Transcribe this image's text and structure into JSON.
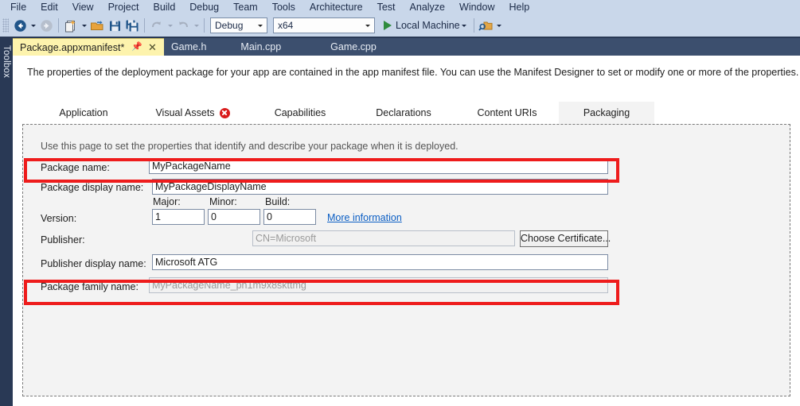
{
  "menubar": {
    "items": [
      {
        "label": "File",
        "accel": "F"
      },
      {
        "label": "Edit",
        "accel": "E"
      },
      {
        "label": "View",
        "accel": "V"
      },
      {
        "label": "Project",
        "accel": "P"
      },
      {
        "label": "Build",
        "accel": "B"
      },
      {
        "label": "Debug",
        "accel": "D"
      },
      {
        "label": "Team",
        "accel": "m"
      },
      {
        "label": "Tools",
        "accel": "T"
      },
      {
        "label": "Architecture",
        "accel": ""
      },
      {
        "label": "Test",
        "accel": "s"
      },
      {
        "label": "Analyze",
        "accel": "n"
      },
      {
        "label": "Window",
        "accel": "W"
      },
      {
        "label": "Help",
        "accel": "H"
      }
    ]
  },
  "toolbar": {
    "icons": [
      "navigate-back-icon",
      "navigate-forward-icon",
      "new-item-icon",
      "open-file-icon",
      "save-icon",
      "save-all-icon",
      "undo-icon",
      "redo-icon",
      "find-in-files-icon"
    ],
    "configuration": "Debug",
    "platform": "x64",
    "run_target": "Local Machine"
  },
  "dock": {
    "toolbox_label": "Toolbox"
  },
  "document_tabs": [
    {
      "label": "Package.appxmanifest*",
      "active": true,
      "pin_icon": "pin-icon",
      "close_icon": "close-icon"
    },
    {
      "label": "Game.h",
      "active": false
    },
    {
      "label": "Main.cpp",
      "active": false
    },
    {
      "label": "Game.cpp",
      "active": false
    }
  ],
  "designer": {
    "intro": "The properties of the deployment package for your app are contained in the app manifest file. You can use the Manifest Designer to set or modify one or more of the properties.",
    "tabs": [
      {
        "label": "Application",
        "selected": false,
        "error": false
      },
      {
        "label": "Visual Assets",
        "selected": false,
        "error": true,
        "error_icon": "error-icon"
      },
      {
        "label": "Capabilities",
        "selected": false,
        "error": false
      },
      {
        "label": "Declarations",
        "selected": false,
        "error": false
      },
      {
        "label": "Content URIs",
        "selected": false,
        "error": false
      },
      {
        "label": "Packaging",
        "selected": true,
        "error": false
      }
    ],
    "page_hint": "Use this page to set the properties that identify and describe your package when it is deployed.",
    "fields": {
      "package_name": {
        "label": "Package name:",
        "value": "MyPackageName",
        "disabled": false
      },
      "package_display_name": {
        "label": "Package display name:",
        "value": "MyPackageDisplayName",
        "disabled": false
      },
      "version": {
        "label": "Version:",
        "major_label": "Major:",
        "major_value": "1",
        "minor_label": "Minor:",
        "minor_value": "0",
        "build_label": "Build:",
        "build_value": "0",
        "more_info_link": "More information"
      },
      "publisher": {
        "label": "Publisher:",
        "value": "CN=Microsoft",
        "disabled": true,
        "button": "Choose Certificate..."
      },
      "publisher_display_name": {
        "label": "Publisher display name:",
        "value": "Microsoft ATG",
        "disabled": false
      },
      "package_family_name": {
        "label": "Package family name:",
        "value": "MyPackageName_ph1m9x8skttmg",
        "disabled": true
      }
    }
  },
  "annotations": {
    "highlight_color": "#ee1c1c",
    "boxes": [
      "package-name-highlight",
      "package-family-name-highlight"
    ]
  }
}
